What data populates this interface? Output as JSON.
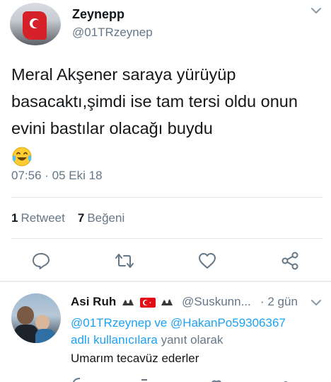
{
  "tweet": {
    "display_name": "Zeynepp",
    "handle": "@01TRzeynep",
    "text": "Meral Akşener saraya yürüyüp basacaktı,şimdi ise tam tersi oldu onun evini bastılar olacağı buydu",
    "emoji": "tears-of-joy",
    "timestamp": "07:56 · 05 Eki 18",
    "stats": {
      "retweets_count": "1",
      "retweets_label": "Retweet",
      "likes_count": "7",
      "likes_label": "Beğeni"
    },
    "actions": [
      "reply",
      "retweet",
      "like",
      "share"
    ]
  },
  "reply": {
    "display_name": "Asi Ruh",
    "handle": "@Suskunn...",
    "time": "· 2 gün",
    "reply_to_prefix": "@01TRzeynep ve @HakanPo59306367",
    "reply_to_mid": "adlı kullanıcılara",
    "reply_to_suffix": "yanıt olarak",
    "text": "Umarım tecavüz ederler"
  },
  "colors": {
    "text": "#14171a",
    "secondary": "#657786",
    "link": "#1da1f2",
    "divider": "#e1e8ed"
  }
}
